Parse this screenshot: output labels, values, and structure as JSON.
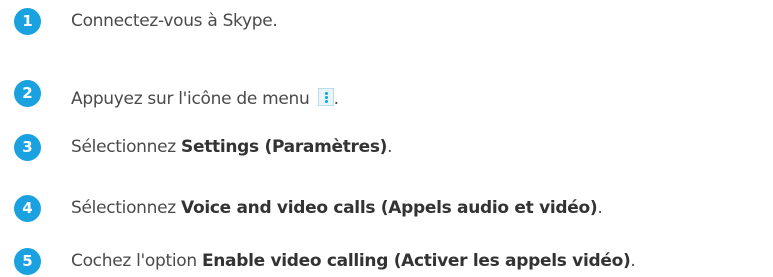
{
  "colors": {
    "badge": "#1aa2e0",
    "text": "#4a4a4a",
    "menu_icon": "#00a9e0"
  },
  "steps": [
    {
      "number": "1",
      "text": "Connectez-vous à Skype."
    },
    {
      "number": "2",
      "text": "Appuyez sur l'icône de menu",
      "icon": "menu-dots-icon",
      "suffix": "."
    },
    {
      "number": "3",
      "prefix": "Sélectionnez ",
      "bold": "Settings (Paramètres)",
      "suffix": "."
    },
    {
      "number": "4",
      "prefix": "Sélectionnez ",
      "bold": "Voice and video calls (Appels audio et vidéo)",
      "suffix": "."
    },
    {
      "number": "5",
      "prefix": "Cochez l'option ",
      "bold": "Enable video calling (Activer les appels vidéo)",
      "suffix": "."
    }
  ]
}
